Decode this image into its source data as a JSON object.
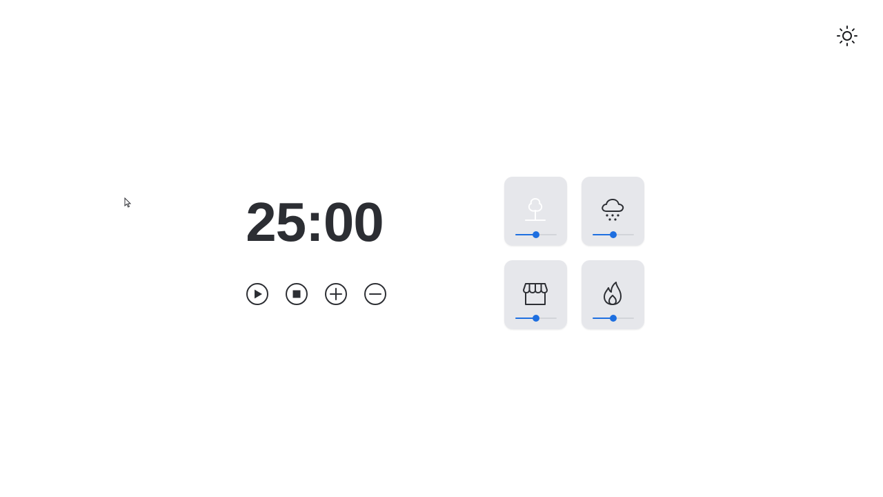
{
  "timer": {
    "display": "25:00"
  },
  "header": {
    "theme_toggle_icon": "sun-icon"
  },
  "controls": [
    {
      "action": "play",
      "icon": "play-circle-icon"
    },
    {
      "action": "stop",
      "icon": "stop-circle-icon"
    },
    {
      "action": "add",
      "icon": "plus-circle-icon"
    },
    {
      "action": "subtract",
      "icon": "minus-circle-icon"
    }
  ],
  "sounds": [
    {
      "icon": "tree-icon",
      "volume": 0.5
    },
    {
      "icon": "rain-cloud-icon",
      "volume": 0.5
    },
    {
      "icon": "store-icon",
      "volume": 0.5
    },
    {
      "icon": "fire-icon",
      "volume": 0.5
    }
  ],
  "colors": {
    "accent": "#1e6fe0",
    "text": "#2c2e33",
    "tile_bg": "#e6e7eb",
    "track": "#d2d4d9"
  }
}
